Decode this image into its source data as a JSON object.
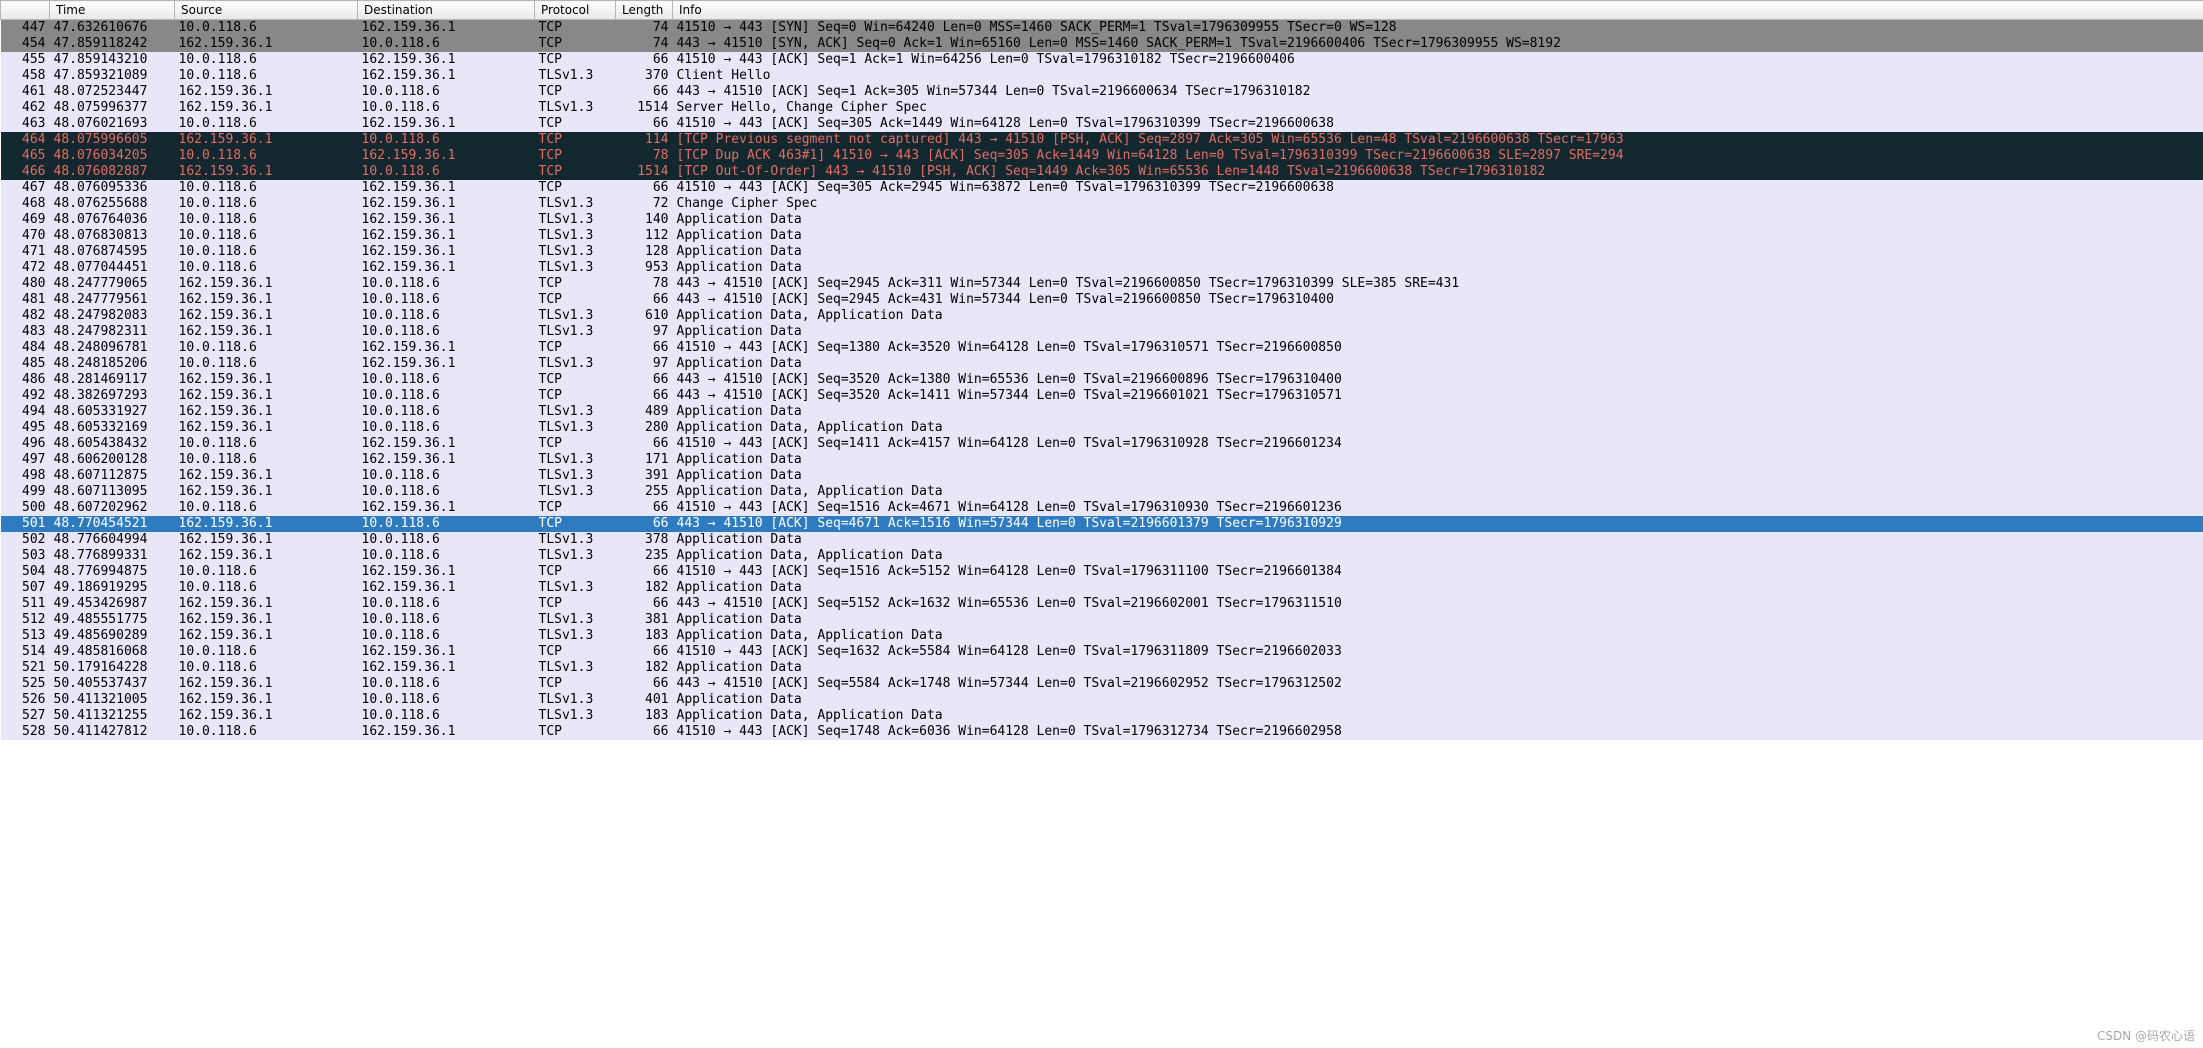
{
  "columns": [
    "",
    "Time",
    "Source",
    "Destination",
    "Protocol",
    "Length",
    "Info"
  ],
  "watermark": "CSDN @码农心语",
  "rows": [
    {
      "no": "447",
      "time": "47.632610676",
      "src": "10.0.118.6",
      "dst": "162.159.36.1",
      "proto": "TCP",
      "len": "74",
      "info": "41510 → 443 [SYN] Seq=0 Win=64240 Len=0 MSS=1460 SACK_PERM=1 TSval=1796309955 TSecr=0 WS=128",
      "style": "ignored"
    },
    {
      "no": "454",
      "time": "47.859118242",
      "src": "162.159.36.1",
      "dst": "10.0.118.6",
      "proto": "TCP",
      "len": "74",
      "info": "443 → 41510 [SYN, ACK] Seq=0 Ack=1 Win=65160 Len=0 MSS=1460 SACK_PERM=1 TSval=2196600406 TSecr=1796309955 WS=8192",
      "style": "ignored"
    },
    {
      "no": "455",
      "time": "47.859143210",
      "src": "10.0.118.6",
      "dst": "162.159.36.1",
      "proto": "TCP",
      "len": "66",
      "info": "41510 → 443 [ACK] Seq=1 Ack=1 Win=64256 Len=0 TSval=1796310182 TSecr=2196600406",
      "style": "client"
    },
    {
      "no": "458",
      "time": "47.859321089",
      "src": "10.0.118.6",
      "dst": "162.159.36.1",
      "proto": "TLSv1.3",
      "len": "370",
      "info": "Client Hello",
      "style": "client"
    },
    {
      "no": "461",
      "time": "48.072523447",
      "src": "162.159.36.1",
      "dst": "10.0.118.6",
      "proto": "TCP",
      "len": "66",
      "info": "443 → 41510 [ACK] Seq=1 Ack=305 Win=57344 Len=0 TSval=2196600634 TSecr=1796310182",
      "style": "client"
    },
    {
      "no": "462",
      "time": "48.075996377",
      "src": "162.159.36.1",
      "dst": "10.0.118.6",
      "proto": "TLSv1.3",
      "len": "1514",
      "info": "Server Hello, Change Cipher Spec",
      "style": "client"
    },
    {
      "no": "463",
      "time": "48.076021693",
      "src": "10.0.118.6",
      "dst": "162.159.36.1",
      "proto": "TCP",
      "len": "66",
      "info": "41510 → 443 [ACK] Seq=305 Ack=1449 Win=64128 Len=0 TSval=1796310399 TSecr=2196600638",
      "style": "client"
    },
    {
      "no": "464",
      "time": "48.075996605",
      "src": "162.159.36.1",
      "dst": "10.0.118.6",
      "proto": "TCP",
      "len": "114",
      "info": "[TCP Previous segment not captured] 443 → 41510 [PSH, ACK] Seq=2897 Ack=305 Win=65536 Len=48 TSval=2196600638 TSecr=17963",
      "style": "error"
    },
    {
      "no": "465",
      "time": "48.076034205",
      "src": "10.0.118.6",
      "dst": "162.159.36.1",
      "proto": "TCP",
      "len": "78",
      "info": "[TCP Dup ACK 463#1] 41510 → 443 [ACK] Seq=305 Ack=1449 Win=64128 Len=0 TSval=1796310399 TSecr=2196600638 SLE=2897 SRE=294",
      "style": "error"
    },
    {
      "no": "466",
      "time": "48.076082887",
      "src": "162.159.36.1",
      "dst": "10.0.118.6",
      "proto": "TCP",
      "len": "1514",
      "info": "[TCP Out-Of-Order] 443 → 41510 [PSH, ACK] Seq=1449 Ack=305 Win=65536 Len=1448 TSval=2196600638 TSecr=1796310182",
      "style": "error"
    },
    {
      "no": "467",
      "time": "48.076095336",
      "src": "10.0.118.6",
      "dst": "162.159.36.1",
      "proto": "TCP",
      "len": "66",
      "info": "41510 → 443 [ACK] Seq=305 Ack=2945 Win=63872 Len=0 TSval=1796310399 TSecr=2196600638",
      "style": "client"
    },
    {
      "no": "468",
      "time": "48.076255688",
      "src": "10.0.118.6",
      "dst": "162.159.36.1",
      "proto": "TLSv1.3",
      "len": "72",
      "info": "Change Cipher Spec",
      "style": "client"
    },
    {
      "no": "469",
      "time": "48.076764036",
      "src": "10.0.118.6",
      "dst": "162.159.36.1",
      "proto": "TLSv1.3",
      "len": "140",
      "info": "Application Data",
      "style": "client"
    },
    {
      "no": "470",
      "time": "48.076830813",
      "src": "10.0.118.6",
      "dst": "162.159.36.1",
      "proto": "TLSv1.3",
      "len": "112",
      "info": "Application Data",
      "style": "client"
    },
    {
      "no": "471",
      "time": "48.076874595",
      "src": "10.0.118.6",
      "dst": "162.159.36.1",
      "proto": "TLSv1.3",
      "len": "128",
      "info": "Application Data",
      "style": "client"
    },
    {
      "no": "472",
      "time": "48.077044451",
      "src": "10.0.118.6",
      "dst": "162.159.36.1",
      "proto": "TLSv1.3",
      "len": "953",
      "info": "Application Data",
      "style": "client"
    },
    {
      "no": "480",
      "time": "48.247779065",
      "src": "162.159.36.1",
      "dst": "10.0.118.6",
      "proto": "TCP",
      "len": "78",
      "info": "443 → 41510 [ACK] Seq=2945 Ack=311 Win=57344 Len=0 TSval=2196600850 TSecr=1796310399 SLE=385 SRE=431",
      "style": "client"
    },
    {
      "no": "481",
      "time": "48.247779561",
      "src": "162.159.36.1",
      "dst": "10.0.118.6",
      "proto": "TCP",
      "len": "66",
      "info": "443 → 41510 [ACK] Seq=2945 Ack=431 Win=57344 Len=0 TSval=2196600850 TSecr=1796310400",
      "style": "client"
    },
    {
      "no": "482",
      "time": "48.247982083",
      "src": "162.159.36.1",
      "dst": "10.0.118.6",
      "proto": "TLSv1.3",
      "len": "610",
      "info": "Application Data, Application Data",
      "style": "client"
    },
    {
      "no": "483",
      "time": "48.247982311",
      "src": "162.159.36.1",
      "dst": "10.0.118.6",
      "proto": "TLSv1.3",
      "len": "97",
      "info": "Application Data",
      "style": "client"
    },
    {
      "no": "484",
      "time": "48.248096781",
      "src": "10.0.118.6",
      "dst": "162.159.36.1",
      "proto": "TCP",
      "len": "66",
      "info": "41510 → 443 [ACK] Seq=1380 Ack=3520 Win=64128 Len=0 TSval=1796310571 TSecr=2196600850",
      "style": "client"
    },
    {
      "no": "485",
      "time": "48.248185206",
      "src": "10.0.118.6",
      "dst": "162.159.36.1",
      "proto": "TLSv1.3",
      "len": "97",
      "info": "Application Data",
      "style": "client"
    },
    {
      "no": "486",
      "time": "48.281469117",
      "src": "162.159.36.1",
      "dst": "10.0.118.6",
      "proto": "TCP",
      "len": "66",
      "info": "443 → 41510 [ACK] Seq=3520 Ack=1380 Win=65536 Len=0 TSval=2196600896 TSecr=1796310400",
      "style": "client"
    },
    {
      "no": "492",
      "time": "48.382697293",
      "src": "162.159.36.1",
      "dst": "10.0.118.6",
      "proto": "TCP",
      "len": "66",
      "info": "443 → 41510 [ACK] Seq=3520 Ack=1411 Win=57344 Len=0 TSval=2196601021 TSecr=1796310571",
      "style": "client"
    },
    {
      "no": "494",
      "time": "48.605331927",
      "src": "162.159.36.1",
      "dst": "10.0.118.6",
      "proto": "TLSv1.3",
      "len": "489",
      "info": "Application Data",
      "style": "client"
    },
    {
      "no": "495",
      "time": "48.605332169",
      "src": "162.159.36.1",
      "dst": "10.0.118.6",
      "proto": "TLSv1.3",
      "len": "280",
      "info": "Application Data, Application Data",
      "style": "client"
    },
    {
      "no": "496",
      "time": "48.605438432",
      "src": "10.0.118.6",
      "dst": "162.159.36.1",
      "proto": "TCP",
      "len": "66",
      "info": "41510 → 443 [ACK] Seq=1411 Ack=4157 Win=64128 Len=0 TSval=1796310928 TSecr=2196601234",
      "style": "client"
    },
    {
      "no": "497",
      "time": "48.606200128",
      "src": "10.0.118.6",
      "dst": "162.159.36.1",
      "proto": "TLSv1.3",
      "len": "171",
      "info": "Application Data",
      "style": "client"
    },
    {
      "no": "498",
      "time": "48.607112875",
      "src": "162.159.36.1",
      "dst": "10.0.118.6",
      "proto": "TLSv1.3",
      "len": "391",
      "info": "Application Data",
      "style": "client"
    },
    {
      "no": "499",
      "time": "48.607113095",
      "src": "162.159.36.1",
      "dst": "10.0.118.6",
      "proto": "TLSv1.3",
      "len": "255",
      "info": "Application Data, Application Data",
      "style": "client"
    },
    {
      "no": "500",
      "time": "48.607202962",
      "src": "10.0.118.6",
      "dst": "162.159.36.1",
      "proto": "TCP",
      "len": "66",
      "info": "41510 → 443 [ACK] Seq=1516 Ack=4671 Win=64128 Len=0 TSval=1796310930 TSecr=2196601236",
      "style": "client"
    },
    {
      "no": "501",
      "time": "48.770454521",
      "src": "162.159.36.1",
      "dst": "10.0.118.6",
      "proto": "TCP",
      "len": "66",
      "info": "443 → 41510 [ACK] Seq=4671 Ack=1516 Win=57344 Len=0 TSval=2196601379 TSecr=1796310929",
      "style": "selected"
    },
    {
      "no": "502",
      "time": "48.776604994",
      "src": "162.159.36.1",
      "dst": "10.0.118.6",
      "proto": "TLSv1.3",
      "len": "378",
      "info": "Application Data",
      "style": "client"
    },
    {
      "no": "503",
      "time": "48.776899331",
      "src": "162.159.36.1",
      "dst": "10.0.118.6",
      "proto": "TLSv1.3",
      "len": "235",
      "info": "Application Data, Application Data",
      "style": "client"
    },
    {
      "no": "504",
      "time": "48.776994875",
      "src": "10.0.118.6",
      "dst": "162.159.36.1",
      "proto": "TCP",
      "len": "66",
      "info": "41510 → 443 [ACK] Seq=1516 Ack=5152 Win=64128 Len=0 TSval=1796311100 TSecr=2196601384",
      "style": "client"
    },
    {
      "no": "507",
      "time": "49.186919295",
      "src": "10.0.118.6",
      "dst": "162.159.36.1",
      "proto": "TLSv1.3",
      "len": "182",
      "info": "Application Data",
      "style": "client"
    },
    {
      "no": "511",
      "time": "49.453426987",
      "src": "162.159.36.1",
      "dst": "10.0.118.6",
      "proto": "TCP",
      "len": "66",
      "info": "443 → 41510 [ACK] Seq=5152 Ack=1632 Win=65536 Len=0 TSval=2196602001 TSecr=1796311510",
      "style": "client"
    },
    {
      "no": "512",
      "time": "49.485551775",
      "src": "162.159.36.1",
      "dst": "10.0.118.6",
      "proto": "TLSv1.3",
      "len": "381",
      "info": "Application Data",
      "style": "client"
    },
    {
      "no": "513",
      "time": "49.485690289",
      "src": "162.159.36.1",
      "dst": "10.0.118.6",
      "proto": "TLSv1.3",
      "len": "183",
      "info": "Application Data, Application Data",
      "style": "client"
    },
    {
      "no": "514",
      "time": "49.485816068",
      "src": "10.0.118.6",
      "dst": "162.159.36.1",
      "proto": "TCP",
      "len": "66",
      "info": "41510 → 443 [ACK] Seq=1632 Ack=5584 Win=64128 Len=0 TSval=1796311809 TSecr=2196602033",
      "style": "client"
    },
    {
      "no": "521",
      "time": "50.179164228",
      "src": "10.0.118.6",
      "dst": "162.159.36.1",
      "proto": "TLSv1.3",
      "len": "182",
      "info": "Application Data",
      "style": "client"
    },
    {
      "no": "525",
      "time": "50.405537437",
      "src": "162.159.36.1",
      "dst": "10.0.118.6",
      "proto": "TCP",
      "len": "66",
      "info": "443 → 41510 [ACK] Seq=5584 Ack=1748 Win=57344 Len=0 TSval=2196602952 TSecr=1796312502",
      "style": "client"
    },
    {
      "no": "526",
      "time": "50.411321005",
      "src": "162.159.36.1",
      "dst": "10.0.118.6",
      "proto": "TLSv1.3",
      "len": "401",
      "info": "Application Data",
      "style": "client"
    },
    {
      "no": "527",
      "time": "50.411321255",
      "src": "162.159.36.1",
      "dst": "10.0.118.6",
      "proto": "TLSv1.3",
      "len": "183",
      "info": "Application Data, Application Data",
      "style": "client"
    },
    {
      "no": "528",
      "time": "50.411427812",
      "src": "10.0.118.6",
      "dst": "162.159.36.1",
      "proto": "TCP",
      "len": "66",
      "info": "41510 → 443 [ACK] Seq=1748 Ack=6036 Win=64128 Len=0 TSval=1796312734 TSecr=2196602958",
      "style": "client"
    }
  ]
}
